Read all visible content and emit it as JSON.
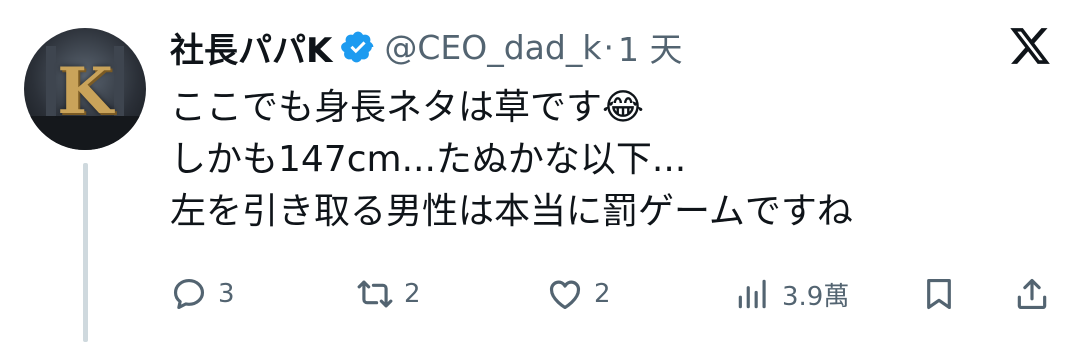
{
  "tweet": {
    "author_name": "社長パパK",
    "handle": "@CEO_dad_k",
    "separator": "·",
    "time": "1 天",
    "lines": [
      "ここでも身長ネタは草です😂",
      "しかも147cm...たぬかな以下...",
      "左を引き取る男性は本当に罰ゲームですね"
    ]
  },
  "actions": {
    "reply_count": "3",
    "retweet_count": "2",
    "like_count": "2",
    "views_count": "3.9萬"
  },
  "icons": {
    "verified": "verified-badge-icon",
    "logo": "x-logo-icon",
    "reply": "reply-icon",
    "retweet": "retweet-icon",
    "like": "heart-icon",
    "views": "views-icon",
    "bookmark": "bookmark-icon",
    "share": "share-icon"
  },
  "colors": {
    "text": "#0f1419",
    "secondary": "#536471",
    "verified": "#1d9bf0",
    "thread_line": "#cfd9de"
  }
}
